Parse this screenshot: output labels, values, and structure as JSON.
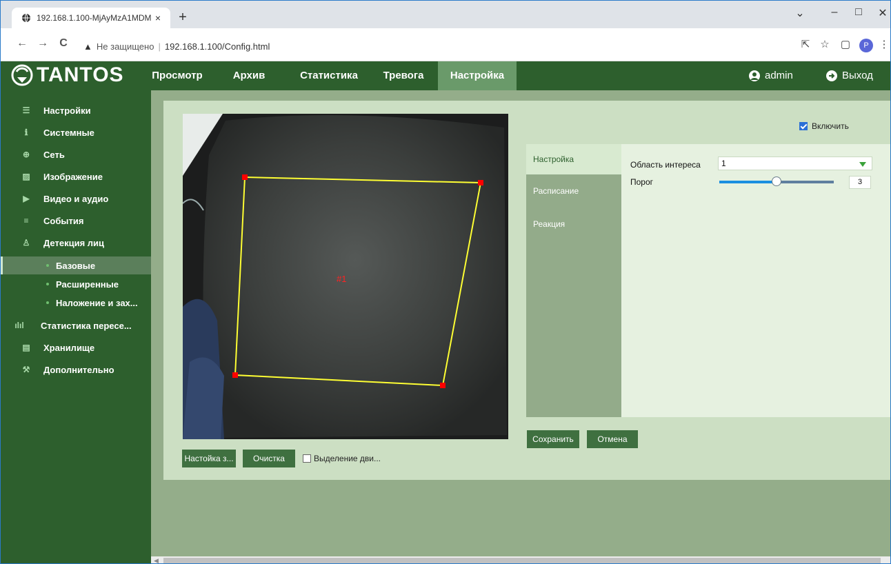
{
  "browser": {
    "tab_title": "192.168.1.100-MjAyMzA1MDMx",
    "tab_close": "×",
    "new_tab": "+",
    "win_min": "–",
    "win_max": "□",
    "win_close": "✕",
    "win_dropdown": "⌄",
    "not_secure_icon": "▲",
    "not_secure_label": "Не защищено",
    "url_separator": "|",
    "url": "192.168.1.100/Config.html",
    "back": "←",
    "forward": "→",
    "reload": "C",
    "profile_initial": "P"
  },
  "header": {
    "logo_text": "TANTOS",
    "menu": [
      {
        "label": "Просмотр"
      },
      {
        "label": "Архив"
      },
      {
        "label": "Статистика"
      },
      {
        "label": "Тревога"
      },
      {
        "label": "Настройка"
      }
    ],
    "active_menu": "Настройка",
    "user_label": "admin",
    "logout_label": "Выход"
  },
  "sidebar": {
    "items": [
      {
        "label": "Настройки",
        "icon": "menu-lines-icon"
      },
      {
        "label": "Системные",
        "icon": "info-icon"
      },
      {
        "label": "Сеть",
        "icon": "globe-icon"
      },
      {
        "label": "Изображение",
        "icon": "image-icon"
      },
      {
        "label": "Видео и аудио",
        "icon": "video-icon"
      },
      {
        "label": "События",
        "icon": "events-icon"
      },
      {
        "label": "Детекция лиц",
        "icon": "person-icon"
      }
    ],
    "sub_items": [
      {
        "label": "Базовые",
        "active": true
      },
      {
        "label": "Расширенные",
        "active": false
      },
      {
        "label": "Наложение и зах...",
        "active": false
      }
    ],
    "items_after": [
      {
        "label": "Статистика пересе...",
        "icon": "bar-chart-icon"
      },
      {
        "label": "Хранилище",
        "icon": "storage-icon"
      },
      {
        "label": "Дополнительно",
        "icon": "tools-icon"
      }
    ]
  },
  "video": {
    "region_label": "#1"
  },
  "buttons": {
    "setup_zone": "Настойка з...",
    "clear": "Очистка",
    "motion_select": "Выделение дви...",
    "save": "Сохранить",
    "cancel": "Отмена"
  },
  "enable_label": "Включить",
  "enable_checked": true,
  "tabs": [
    {
      "label": "Настройка",
      "active": true
    },
    {
      "label": "Расписание",
      "active": false
    },
    {
      "label": "Реакция",
      "active": false
    }
  ],
  "settings": {
    "roi_label": "Область интереса",
    "roi_value": "1",
    "threshold_label": "Порог",
    "threshold_value": "3",
    "threshold_fraction": 0.5
  },
  "colors": {
    "brand_dark_green": "#2d5f2d",
    "active_tab_green": "#6a9a6a",
    "roi_line": "#ffff33",
    "roi_point": "#ff0000",
    "slider_blue": "#1b8fe0"
  }
}
